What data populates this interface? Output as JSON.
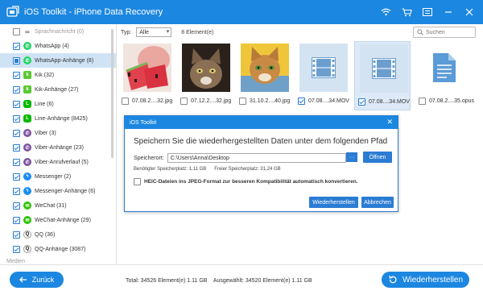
{
  "window": {
    "title": "iOS Toolkit - iPhone Data Recovery",
    "icons": [
      "wifi-icon",
      "cart-icon",
      "menu-icon",
      "minimize-icon",
      "close-icon"
    ]
  },
  "sidebar": {
    "items": [
      {
        "label": "Sprachnachricht (0)",
        "checked": "none",
        "icon": "link-icon"
      },
      {
        "label": "WhatsApp (4)",
        "checked": "yes",
        "icon": "whatsapp-icon"
      },
      {
        "label": "WhatsApp-Anhänge (8)",
        "checked": "partial",
        "icon": "whatsapp-icon",
        "selected": true
      },
      {
        "label": "Kik (32)",
        "checked": "yes",
        "icon": "kik-icon"
      },
      {
        "label": "Kik-Anhänge (27)",
        "checked": "yes",
        "icon": "kik-icon"
      },
      {
        "label": "Line (6)",
        "checked": "yes",
        "icon": "line-icon"
      },
      {
        "label": "Line-Anhänge (8425)",
        "checked": "yes",
        "icon": "line-icon"
      },
      {
        "label": "Viber (3)",
        "checked": "yes",
        "icon": "viber-icon"
      },
      {
        "label": "Viber-Anhänge (23)",
        "checked": "yes",
        "icon": "viber-icon"
      },
      {
        "label": "Viber-Anrufverlauf (5)",
        "checked": "yes",
        "icon": "viber-icon"
      },
      {
        "label": "Messenger (2)",
        "checked": "yes",
        "icon": "messenger-icon"
      },
      {
        "label": "Messenger-Anhänge (6)",
        "checked": "yes",
        "icon": "messenger-icon"
      },
      {
        "label": "WeChat (31)",
        "checked": "yes",
        "icon": "wechat-icon"
      },
      {
        "label": "WeChat-Anhänge (29)",
        "checked": "yes",
        "icon": "wechat-icon"
      },
      {
        "label": "QQ (36)",
        "checked": "yes",
        "icon": "qq-icon"
      },
      {
        "label": "QQ-Anhänge (3087)",
        "checked": "yes",
        "icon": "qq-icon"
      }
    ],
    "section_label": "Medien"
  },
  "filter": {
    "type_label": "Typ:",
    "type_value": "Alle",
    "count_text": "8 Element(e)",
    "search_placeholder": "Suchen"
  },
  "thumbnails": [
    {
      "caption": "07.08.2....32.jpg",
      "kind": "photo-watermelon",
      "checked": false,
      "selected": false
    },
    {
      "caption": "07.12.2....32.jpg",
      "kind": "photo-cat",
      "checked": false,
      "selected": false
    },
    {
      "caption": "31.10.2....40.jpg",
      "kind": "photo-cat-yellow",
      "checked": false,
      "selected": false
    },
    {
      "caption": "07.08....34.MOV",
      "kind": "video",
      "checked": true,
      "selected": false
    },
    {
      "caption": "07.08....34.MOV",
      "kind": "video",
      "checked": true,
      "selected": true
    },
    {
      "caption": "07.08.2....35.opus",
      "kind": "document",
      "checked": false,
      "selected": false
    }
  ],
  "dialog": {
    "title": "iOS Toolkit",
    "heading": "Speichern Sie die wiederhergestellten Daten unter dem folgenden Pfad",
    "path_label": "Speicherort:",
    "path_value": "C:\\Users\\Anna\\Desktop",
    "browse_label": "···",
    "open_label": "Öffnen",
    "required_space": "Benötigter Speicherplatz: 1,11 GB",
    "free_space": "Freier Speicherplatz: 31,24 GB",
    "heic_label": "HEIC-Dateien ins JPEG-Format zur besseren Kompatibilität automatisch konvertieren.",
    "recover_label": "Wiederherstellen",
    "cancel_label": "Abbrechen"
  },
  "bottom": {
    "back_label": "Zurück",
    "totals": "Total: 34526 Element(e) 1.11 GB    Ausgewählt: 34520 Element(e) 1.11 GB",
    "recover_label": "Wiederherstellen"
  },
  "colors": {
    "accent": "#1c87e0",
    "selection": "#cfe3f5"
  }
}
